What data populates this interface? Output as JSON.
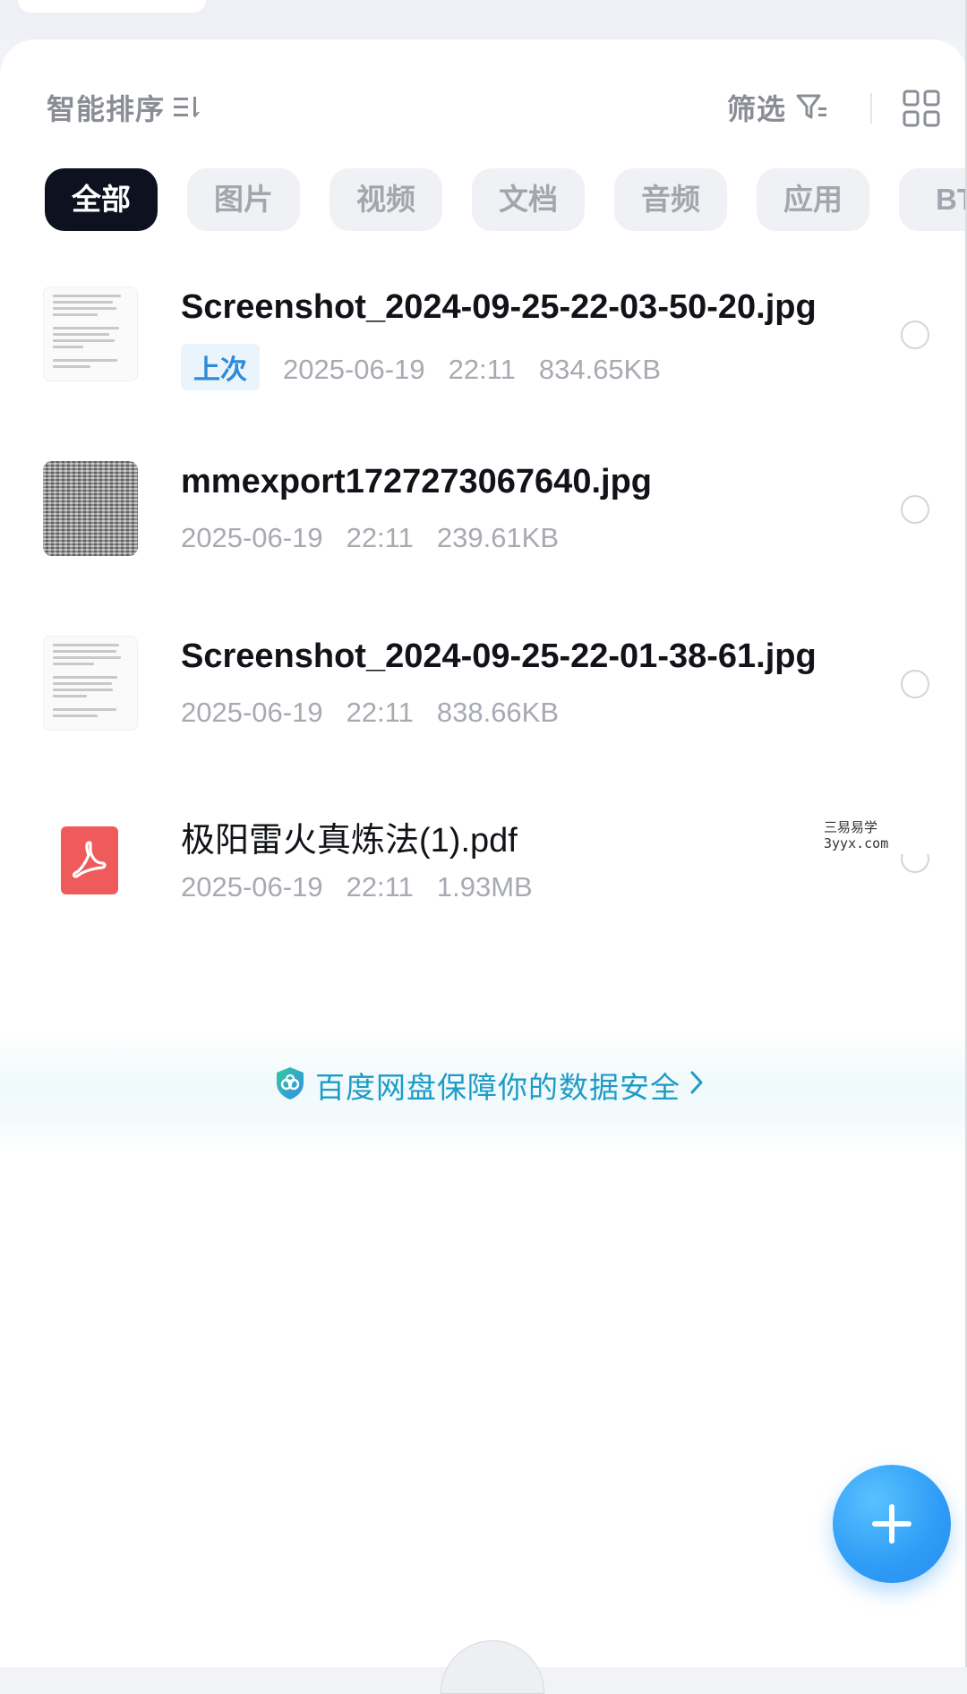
{
  "sort": {
    "label": "智能排序",
    "icon": "sort-icon"
  },
  "filter": {
    "label": "筛选",
    "icon": "filter-icon"
  },
  "view_toggle": {
    "icon": "grid-view-icon"
  },
  "tabs": [
    {
      "label": "全部",
      "active": true
    },
    {
      "label": "图片",
      "active": false
    },
    {
      "label": "视频",
      "active": false
    },
    {
      "label": "文档",
      "active": false
    },
    {
      "label": "音频",
      "active": false
    },
    {
      "label": "应用",
      "active": false
    },
    {
      "label": "BT",
      "active": false
    }
  ],
  "files": [
    {
      "name": "Screenshot_2024-09-25-22-03-50-20.jpg",
      "tag": "上次",
      "date": "2025-06-19",
      "time": "22:11",
      "size": "834.65KB",
      "thumb": "document-screenshot"
    },
    {
      "name": "mmexport1727273067640.jpg",
      "tag": "",
      "date": "2025-06-19",
      "time": "22:11",
      "size": "239.61KB",
      "thumb": "dense-text-image"
    },
    {
      "name": "Screenshot_2024-09-25-22-01-38-61.jpg",
      "tag": "",
      "date": "2025-06-19",
      "time": "22:11",
      "size": "838.66KB",
      "thumb": "document-screenshot"
    },
    {
      "name": "极阳雷火真炼法(1).pdf",
      "tag": "",
      "date": "2025-06-19",
      "time": "22:11",
      "size": "1.93MB",
      "thumb": "pdf-icon"
    }
  ],
  "watermark": {
    "line1": "三易易学",
    "line2": "3yyx.com"
  },
  "banner": {
    "text": "百度网盘保障你的数据安全",
    "icon": "shield-icon"
  },
  "fab": {
    "icon": "plus-icon"
  },
  "colors": {
    "accent": "#2e9bf6",
    "banner_text": "#1e9bc6",
    "active_tab": "#0e1120",
    "pdf": "#ef5a5a"
  }
}
